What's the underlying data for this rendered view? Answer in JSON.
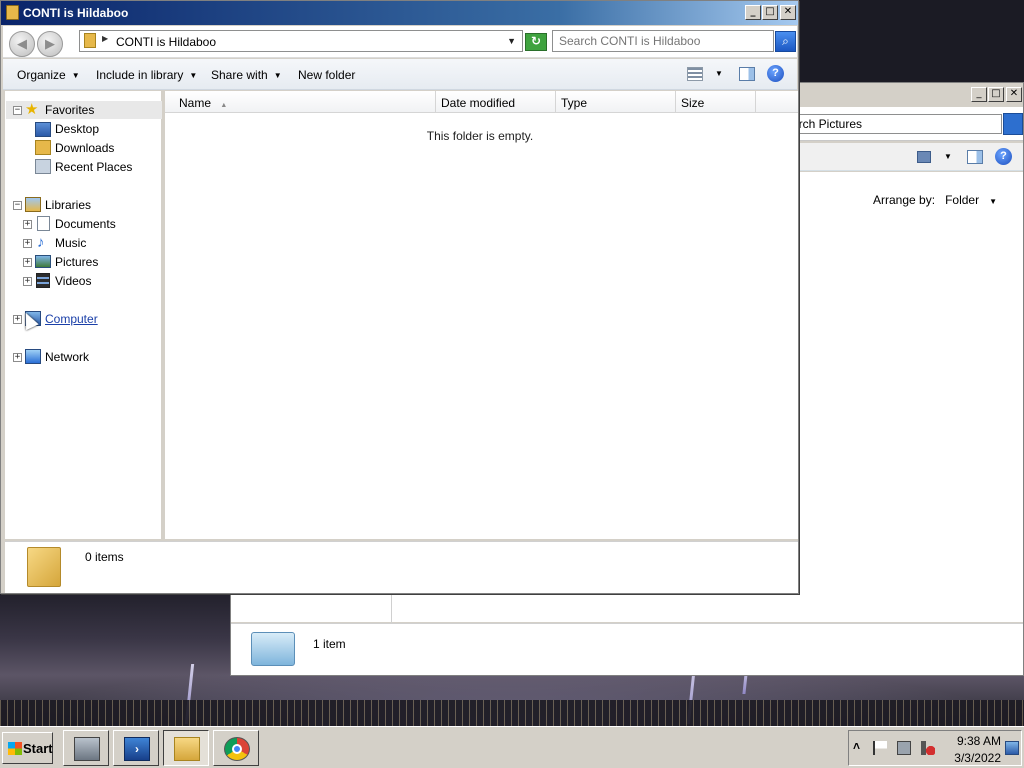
{
  "desktop": {
    "background_window": {
      "search_text": "arch Pictures",
      "arrange_label": "Arrange by:",
      "arrange_value": "Folder",
      "item_count": "1 item"
    }
  },
  "window": {
    "title": "CONTI is Hildaboo",
    "controls": {
      "minimize": "_",
      "maximize": "□",
      "close": "✕"
    },
    "nav": {
      "back_glyph": "◀",
      "forward_glyph": "▶",
      "address_path": "CONTI is Hildaboo",
      "search_placeholder": "Search CONTI is Hildaboo"
    },
    "toolbar": {
      "organize": "Organize",
      "include_in_library": "Include in library",
      "share_with": "Share with",
      "new_folder": "New folder",
      "help": "?"
    },
    "sidebar": {
      "favorites": "Favorites",
      "favorites_items": [
        "Desktop",
        "Downloads",
        "Recent Places"
      ],
      "libraries": "Libraries",
      "library_items": [
        "Documents",
        "Music",
        "Pictures",
        "Videos"
      ],
      "computer": "Computer",
      "network": "Network"
    },
    "columns": [
      "Name",
      "Date modified",
      "Type",
      "Size"
    ],
    "empty_message": "This folder is empty.",
    "status": {
      "item_count": "0 items"
    }
  },
  "taskbar": {
    "start_label": "Start",
    "clock_time": "9:38 AM",
    "clock_date": "3/3/2022",
    "tray_arrow": "˄"
  },
  "colors": {
    "title_gradient_start": "#0a246a",
    "title_gradient_end": "#a6caf0",
    "chrome_gray": "#d4d0c8"
  }
}
